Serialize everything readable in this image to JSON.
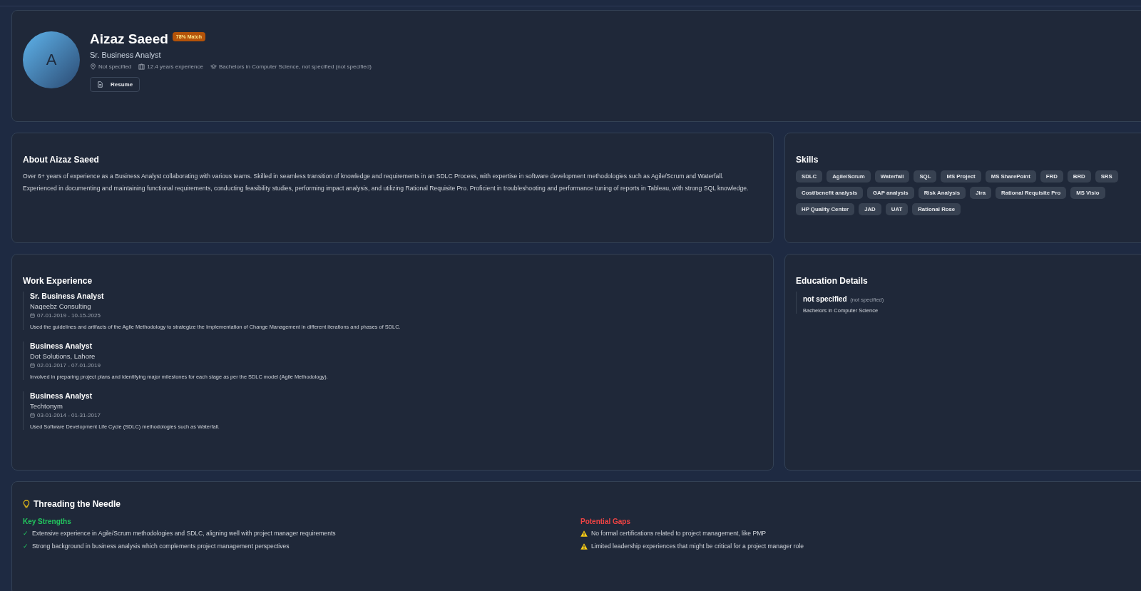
{
  "profile": {
    "avatar_initial": "A",
    "name": "Aizaz Saeed",
    "match_badge": "78% Match",
    "title": "Sr. Business Analyst",
    "location": "Not specified",
    "experience": "12.4 years experience",
    "education": "Bachelors in Computer Science, not specified (not specified)",
    "resume_button": "Resume"
  },
  "about": {
    "heading": "About Aizaz Saeed",
    "text": "Over 6+ years of experience as a Business Analyst collaborating with various teams. Skilled in seamless transition of knowledge and requirements in an SDLC Process, with expertise in software development methodologies such as Agile/Scrum and Waterfall. Experienced in documenting and maintaining functional requirements, conducting feasibility studies, performing impact analysis, and utilizing Rational Requisite Pro. Proficient in troubleshooting and performance tuning of reports in Tableau, with strong SQL knowledge."
  },
  "skills": {
    "heading": "Skills",
    "items": [
      "SDLC",
      "Agile/Scrum",
      "Waterfall",
      "SQL",
      "MS Project",
      "MS SharePoint",
      "FRD",
      "BRD",
      "SRS",
      "Cost/benefit analysis",
      "GAP analysis",
      "Risk Analysis",
      "Jira",
      "Rational Requisite Pro",
      "MS Visio",
      "HP Quality Center",
      "JAD",
      "UAT",
      "Rational Rose"
    ]
  },
  "work_experience": {
    "heading": "Work Experience",
    "jobs": [
      {
        "title": "Sr. Business Analyst",
        "company": "Naqeebz Consulting",
        "dates": "07-01-2019 - 10-15-2025",
        "description": "Used the guidelines and artifacts of the Agile Methodology to strategize the Implementation of Change Management in different iterations and phases of SDLC."
      },
      {
        "title": "Business Analyst",
        "company": "Dot Solutions, Lahore",
        "dates": "02-01-2017 - 07-01-2019",
        "description": "Involved in preparing project plans and identifying major milestones for each stage as per the SDLC model (Agile Methodology)."
      },
      {
        "title": "Business Analyst",
        "company": "Techtonym",
        "dates": "03-01-2014 - 01-31-2017",
        "description": "Used Software Development Life Cycle (SDLC) methodologies such as Waterfall."
      }
    ]
  },
  "education": {
    "heading": "Education Details",
    "entries": [
      {
        "institution": "not specified",
        "note": "(not specified)",
        "degree": "Bachelors in Computer Science"
      }
    ]
  },
  "threading": {
    "heading": "Threading the Needle",
    "strengths_heading": "Key Strengths",
    "strengths": [
      {
        "mark": "✓",
        "text": "Extensive experience in Agile/Scrum methodologies and SDLC, aligning well with project manager requirements"
      },
      {
        "mark": "✓",
        "text": "Strong background in business analysis which complements project management perspectives"
      }
    ],
    "gaps_heading": "Potential Gaps",
    "gaps": [
      "No formal certifications related to project management, like PMP",
      "Limited leadership experiences that might be critical for a project manager role"
    ]
  }
}
